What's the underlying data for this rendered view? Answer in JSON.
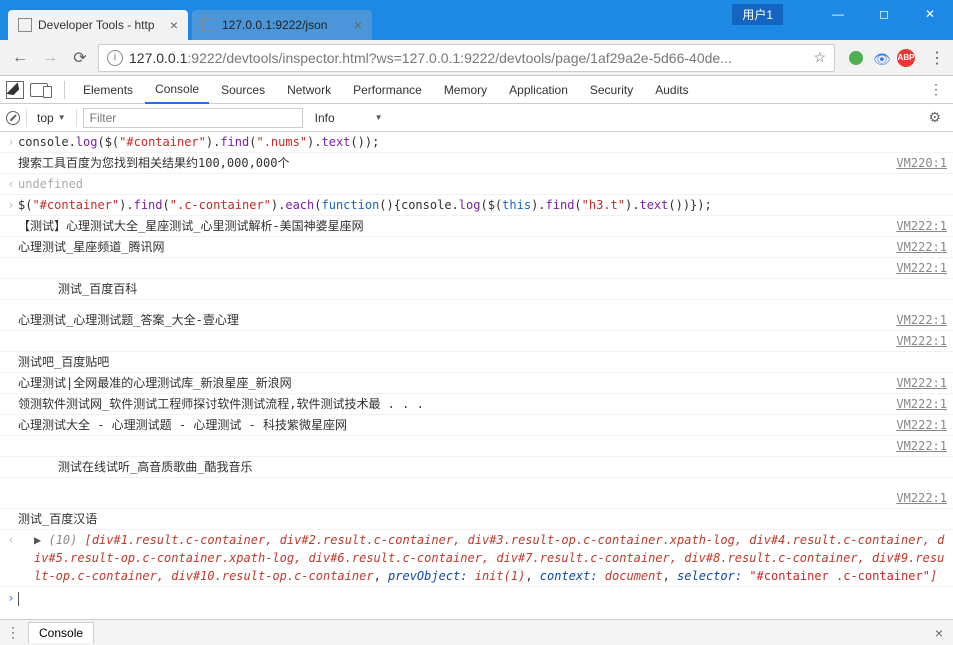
{
  "window": {
    "user_label": "用户1",
    "tabs": [
      {
        "title": "Developer Tools - http",
        "active": true
      },
      {
        "title": "127.0.0.1:9222/json",
        "active": false
      }
    ]
  },
  "address": {
    "host": "127.0.0.1",
    "url_display": ":9222/devtools/inspector.html?ws=127.0.0.1:9222/devtools/page/1af29a2e-5d66-40de...",
    "abp_label": "ABP"
  },
  "devtools": {
    "tabs": [
      "Elements",
      "Console",
      "Sources",
      "Network",
      "Performance",
      "Memory",
      "Application",
      "Security",
      "Audits"
    ],
    "active_tab": "Console"
  },
  "console_toolbar": {
    "context": "top",
    "filter_placeholder": "Filter",
    "level": "Info"
  },
  "lines": [
    {
      "type": "input",
      "code_parts": [
        "console.",
        "log",
        "($(",
        "\"#container\"",
        ").",
        "find",
        "(",
        "\".nums\"",
        ").",
        "text",
        "());"
      ]
    },
    {
      "type": "log",
      "text": "搜索工具百度为您找到相关结果约100,000,000个",
      "src": "VM220:1"
    },
    {
      "type": "return",
      "text": "undefined"
    },
    {
      "type": "input",
      "code_parts": [
        "$(",
        "\"#container\"",
        ").",
        "find",
        "(",
        "\".c-container\"",
        ").",
        "each",
        "(",
        "function",
        "(){console.",
        "log",
        "($(",
        "this",
        ").",
        "find",
        "(",
        "\"h3.t\"",
        ").",
        "text",
        "())});"
      ]
    },
    {
      "type": "log",
      "text": "【测试】心理测试大全_星座测试_心里测试解析-美国神婆星座网",
      "src": "VM222:1"
    },
    {
      "type": "log",
      "text": "心理测试_星座频道_腾讯网",
      "src": "VM222:1"
    },
    {
      "type": "log",
      "text": "",
      "src": "VM222:1"
    },
    {
      "type": "log",
      "indent": true,
      "text": "测试_百度百科"
    },
    {
      "type": "spacer"
    },
    {
      "type": "log",
      "text": "心理测试_心理测试题_答案_大全-壹心理",
      "src": "VM222:1"
    },
    {
      "type": "log",
      "text": "",
      "src": "VM222:1"
    },
    {
      "type": "log",
      "text": "测试吧_百度贴吧"
    },
    {
      "type": "log",
      "text": "心理测试|全网最准的心理测试库_新浪星座_新浪网",
      "src": "VM222:1"
    },
    {
      "type": "log",
      "text": "领测软件测试网_软件测试工程师探讨软件测试流程,软件测试技术最 . . .",
      "src": "VM222:1"
    },
    {
      "type": "log",
      "text": "心理测试大全 - 心理测试题 - 心理测试 - 科技紫微星座网",
      "src": "VM222:1"
    },
    {
      "type": "log",
      "text": "",
      "src": "VM222:1"
    },
    {
      "type": "log",
      "indent": true,
      "text": "测试在线试听_高音质歌曲_酷我音乐"
    },
    {
      "type": "spacer"
    },
    {
      "type": "log",
      "text": "",
      "src": "VM222:1"
    },
    {
      "type": "log",
      "text": "测试_百度汉语"
    }
  ],
  "jquery_return": {
    "count": "(10)",
    "items": "[div#1.result.c-container, div#2.result.c-container, div#3.result-op.c-container.xpath-log, div#4.result.c-container, div#5.result-op.c-container.xpath-log, div#6.result.c-container, div#7.result.c-container, div#8.result.c-container, div#9.result-op.c-container, div#10.result-op.c-container",
    "prev": "prevObject:",
    "prev_val": "init(1)",
    "ctx": "context:",
    "ctx_val": "document",
    "sel": "selector:",
    "sel_val": "\"#container .c-container\"",
    "end": "]"
  },
  "drawer": {
    "label": "Console"
  }
}
